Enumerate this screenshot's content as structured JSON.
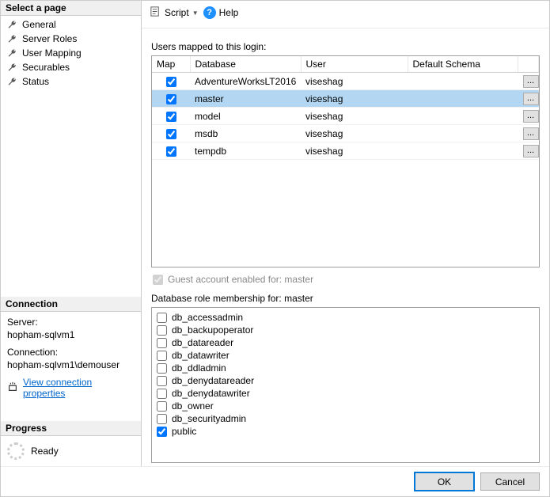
{
  "left": {
    "select_page_header": "Select a page",
    "pages": [
      {
        "label": "General"
      },
      {
        "label": "Server Roles"
      },
      {
        "label": "User Mapping"
      },
      {
        "label": "Securables"
      },
      {
        "label": "Status"
      }
    ],
    "connection_header": "Connection",
    "server_label": "Server:",
    "server_value": "hopham-sqlvm1",
    "connection_label": "Connection:",
    "connection_value": "hopham-sqlvm1\\demouser",
    "view_props_link": "View connection properties",
    "progress_header": "Progress",
    "progress_status": "Ready"
  },
  "toolbar": {
    "script_label": "Script",
    "help_label": "Help"
  },
  "mapping": {
    "caption": "Users mapped to this login:",
    "headers": {
      "map": "Map",
      "database": "Database",
      "user": "User",
      "schema": "Default Schema"
    },
    "rows": [
      {
        "checked": true,
        "database": "AdventureWorksLT2016",
        "user": "viseshag",
        "schema": "",
        "selected": false
      },
      {
        "checked": true,
        "database": "master",
        "user": "viseshag",
        "schema": "",
        "selected": true
      },
      {
        "checked": true,
        "database": "model",
        "user": "viseshag",
        "schema": "",
        "selected": false
      },
      {
        "checked": true,
        "database": "msdb",
        "user": "viseshag",
        "schema": "",
        "selected": false
      },
      {
        "checked": true,
        "database": "tempdb",
        "user": "viseshag",
        "schema": "",
        "selected": false
      }
    ]
  },
  "guest": {
    "label": "Guest account enabled for: master",
    "checked": true,
    "disabled": true
  },
  "roles": {
    "caption": "Database role membership for: master",
    "items": [
      {
        "label": "db_accessadmin",
        "checked": false
      },
      {
        "label": "db_backupoperator",
        "checked": false
      },
      {
        "label": "db_datareader",
        "checked": false
      },
      {
        "label": "db_datawriter",
        "checked": false
      },
      {
        "label": "db_ddladmin",
        "checked": false
      },
      {
        "label": "db_denydatareader",
        "checked": false
      },
      {
        "label": "db_denydatawriter",
        "checked": false
      },
      {
        "label": "db_owner",
        "checked": false
      },
      {
        "label": "db_securityadmin",
        "checked": false
      },
      {
        "label": "public",
        "checked": true
      }
    ]
  },
  "buttons": {
    "ok": "OK",
    "cancel": "Cancel"
  }
}
